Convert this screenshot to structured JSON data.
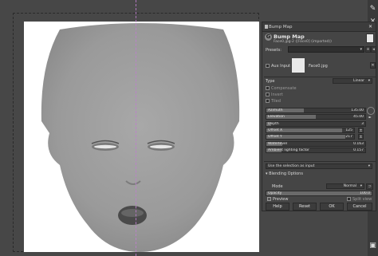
{
  "dialog": {
    "window_title": "Bump Map",
    "header_name": "Bump Map",
    "header_sub": "Face0.jpg-2 ([Face0] (imported))",
    "presets_label": "Presets:",
    "aux_input_label": "Aux Input",
    "aux_input_file": "Face0.jpg",
    "type_label": "Type",
    "type_value": "Linear",
    "compensate_label": "Compensate",
    "invert_label": "Invert",
    "tiled_label": "Tiled",
    "sliders": [
      {
        "label": "Azimuth",
        "value": "135.00",
        "fraction": 0.375
      },
      {
        "label": "Elevation",
        "value": "45.00",
        "fraction": 0.5
      },
      {
        "label": "Depth",
        "value": "3",
        "fraction": 0.05
      },
      {
        "label": "Offset X",
        "value": "125",
        "fraction": 0.86
      },
      {
        "label": "Offset Y",
        "value": "217",
        "fraction": 0.9
      },
      {
        "label": "Waterlevel",
        "value": "0.163",
        "fraction": 0.163
      },
      {
        "label": "Ambient lighting factor",
        "value": "0.157",
        "fraction": 0.157
      }
    ],
    "selection_combo": "Use the selection as input",
    "blending_label": "Blending Options",
    "mode_label": "Mode",
    "mode_value": "Normal",
    "opacity_label": "Opacity",
    "opacity_value": "100.0",
    "opacity_fraction": 1.0,
    "preview_label": "Preview",
    "split_view_label": "Split view",
    "buttons": {
      "help": "Help",
      "reset": "Reset",
      "ok": "OK",
      "cancel": "Cancel"
    }
  },
  "colors": {
    "dialog_bg": "#454545",
    "canvas_bg": "#474747",
    "guide": "#c07cd0",
    "face": "#9a9a9a"
  }
}
